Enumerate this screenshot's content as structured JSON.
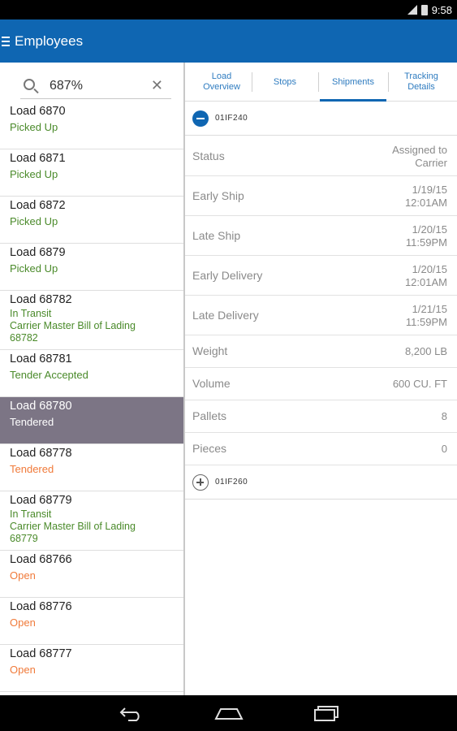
{
  "status_bar": {
    "time": "9:58"
  },
  "app_bar": {
    "title": "Employees"
  },
  "search": {
    "value": "687%",
    "clear_glyph": "✕"
  },
  "loads": [
    {
      "name": "Load 6870",
      "status": "Picked Up",
      "status_color": "green"
    },
    {
      "name": "Load 6871",
      "status": "Picked Up",
      "status_color": "green"
    },
    {
      "name": "Load 6872",
      "status": "Picked Up",
      "status_color": "green"
    },
    {
      "name": "Load 6879",
      "status": "Picked Up",
      "status_color": "green"
    },
    {
      "name": "Load 68782",
      "status": "In Transit",
      "status_color": "green",
      "extra": [
        "Carrier Master Bill of Lading",
        "68782"
      ]
    },
    {
      "name": "Load 68781",
      "status": "Tender Accepted",
      "status_color": "green"
    },
    {
      "name": "Load 68780",
      "status": "Tendered",
      "status_color": "white",
      "selected": true
    },
    {
      "name": "Load 68778",
      "status": "Tendered",
      "status_color": "orange"
    },
    {
      "name": "Load 68779",
      "status": "In Transit",
      "status_color": "green",
      "extra": [
        "Carrier Master Bill of Lading",
        "68779"
      ]
    },
    {
      "name": "Load 68766",
      "status": "Open",
      "status_color": "orange"
    },
    {
      "name": "Load 68776",
      "status": "Open",
      "status_color": "orange"
    },
    {
      "name": "Load 68777",
      "status": "Open",
      "status_color": "orange"
    }
  ],
  "tabs": [
    {
      "label_line1": "Load",
      "label_line2": "Overview",
      "active": false
    },
    {
      "label_line1": "Stops",
      "label_line2": "",
      "active": false
    },
    {
      "label_line1": "Shipments",
      "label_line2": "",
      "active": true
    },
    {
      "label_line1": "Tracking",
      "label_line2": "Details",
      "active": false
    }
  ],
  "shipment_expanded": {
    "id": "01IF240",
    "rows": [
      {
        "label": "Status",
        "value_line1": "Assigned to",
        "value_line2": "Carrier"
      },
      {
        "label": "Early Ship",
        "value_line1": "1/19/15",
        "value_line2": "12:01AM"
      },
      {
        "label": "Late Ship",
        "value_line1": "1/20/15",
        "value_line2": "11:59PM"
      },
      {
        "label": "Early Delivery",
        "value_line1": "1/20/15",
        "value_line2": "12:01AM"
      },
      {
        "label": "Late Delivery",
        "value_line1": "1/21/15",
        "value_line2": "11:59PM"
      },
      {
        "label": "Weight",
        "value_line1": "8,200 LB",
        "value_line2": ""
      },
      {
        "label": "Volume",
        "value_line1": "600 CU. FT",
        "value_line2": ""
      },
      {
        "label": "Pallets",
        "value_line1": "8",
        "value_line2": ""
      },
      {
        "label": "Pieces",
        "value_line1": "0",
        "value_line2": ""
      }
    ]
  },
  "shipment_collapsed": {
    "id": "01IF260"
  },
  "colors": {
    "app_bar": "#0f66b2",
    "status_green": "#4a8a2a",
    "status_orange": "#f07a3a",
    "selected_row": "#7c7585",
    "tab_text": "#2f7cc0"
  },
  "icons": {
    "menu": "hamburger-icon",
    "search": "search-icon",
    "clear": "close-icon",
    "collapse": "minus-circle-icon",
    "expand": "plus-circle-icon",
    "nav_back": "back-icon",
    "nav_home": "home-icon",
    "nav_recents": "recents-icon"
  }
}
